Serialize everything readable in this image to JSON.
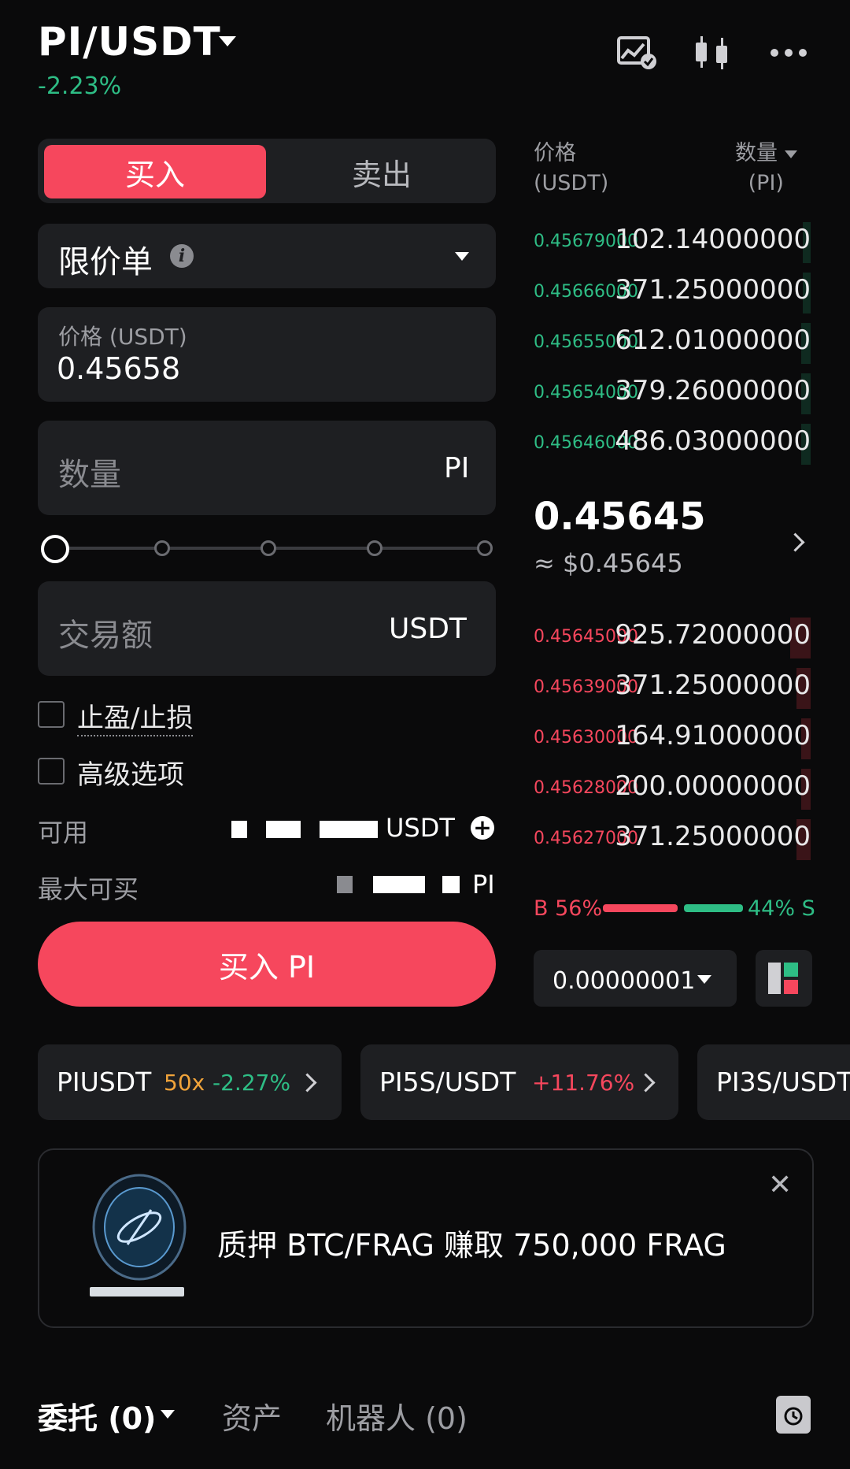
{
  "header": {
    "pair": "PI/USDT",
    "change": "-2.23%"
  },
  "trade_tabs": {
    "buy": "买入",
    "sell": "卖出"
  },
  "order_type": {
    "label": "限价单"
  },
  "price_field": {
    "label": "价格 (USDT)",
    "value": "0.45658"
  },
  "quantity_field": {
    "placeholder": "数量",
    "unit": "PI"
  },
  "amount_field": {
    "placeholder": "交易额",
    "unit": "USDT"
  },
  "slider": {
    "value_percent": 0
  },
  "options": {
    "tp_sl": "止盈/止损",
    "advanced": "高级选项"
  },
  "available": {
    "label": "可用",
    "value_suffix": "USDT"
  },
  "max_buy": {
    "label": "最大可买",
    "value_suffix": "PI"
  },
  "buy_button": "买入 PI",
  "orderbook": {
    "price_header_line1": "价格",
    "price_header_line2": "(USDT)",
    "qty_header_line1": "数量",
    "qty_header_line2": "(PI)",
    "asks": [
      {
        "price": "0.45679000",
        "qty": "102.14000000"
      },
      {
        "price": "0.45666000",
        "qty": "371.25000000"
      },
      {
        "price": "0.45655000",
        "qty": "612.01000000"
      },
      {
        "price": "0.45654000",
        "qty": "379.26000000"
      },
      {
        "price": "0.45646000",
        "qty": "486.03000000"
      }
    ],
    "last_price": "0.45645",
    "last_price_usd": "≈ $0.45645",
    "bids": [
      {
        "price": "0.45645000",
        "qty": "925.72000000"
      },
      {
        "price": "0.45639000",
        "qty": "371.25000000"
      },
      {
        "price": "0.45630000",
        "qty": "164.91000000"
      },
      {
        "price": "0.45628000",
        "qty": "200.00000000"
      },
      {
        "price": "0.45627000",
        "qty": "371.25000000"
      }
    ],
    "buy_ratio_label": "B 56%",
    "sell_ratio_label": "44% S",
    "buy_ratio": 0.56,
    "precision": "0.00000001"
  },
  "markets": [
    {
      "name": "PIUSDT",
      "leverage": "50x",
      "change": "-2.27%"
    },
    {
      "name": "PI5S/USDT",
      "change": "+11.76%"
    },
    {
      "name": "PI3S/USDT"
    }
  ],
  "banner": {
    "text": "质押 BTC/FRAG 赚取 750,000 FRAG"
  },
  "bottom_tabs": {
    "orders": "委托 (0)",
    "assets": "资产",
    "bots": "机器人 (0)"
  },
  "colors": {
    "buy": "#f6475d",
    "green": "#2ebd85",
    "bg": "#0a0a0b",
    "panel": "#1e1f22"
  }
}
